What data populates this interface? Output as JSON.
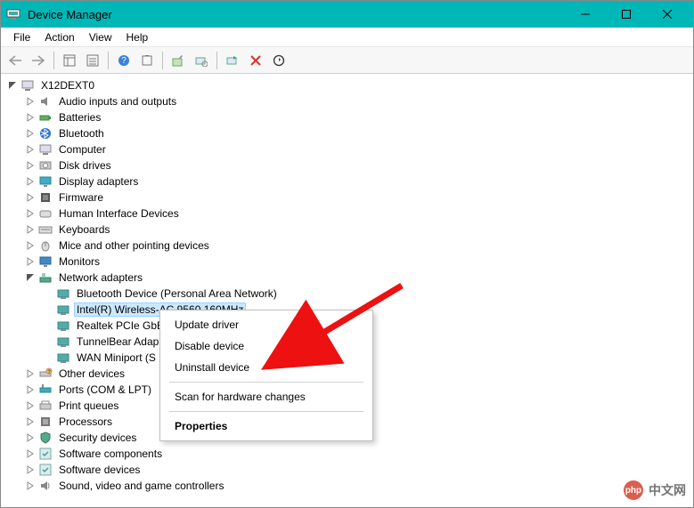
{
  "window": {
    "title": "Device Manager"
  },
  "menu": {
    "file": "File",
    "action": "Action",
    "view": "View",
    "help": "Help"
  },
  "tree": {
    "root": "X12DEXT0",
    "categories": [
      {
        "name": "Audio inputs and outputs"
      },
      {
        "name": "Batteries"
      },
      {
        "name": "Bluetooth"
      },
      {
        "name": "Computer"
      },
      {
        "name": "Disk drives"
      },
      {
        "name": "Display adapters"
      },
      {
        "name": "Firmware"
      },
      {
        "name": "Human Interface Devices"
      },
      {
        "name": "Keyboards"
      },
      {
        "name": "Mice and other pointing devices"
      },
      {
        "name": "Monitors"
      },
      {
        "name": "Network adapters",
        "children": [
          "Bluetooth Device (Personal Area Network)",
          "Intel(R) Wireless-AC 9560 160MHz",
          "Realtek PCIe GbE",
          "TunnelBear Adap",
          "WAN Miniport (S"
        ],
        "selected_index": 1
      },
      {
        "name": "Other devices"
      },
      {
        "name": "Ports (COM & LPT)"
      },
      {
        "name": "Print queues"
      },
      {
        "name": "Processors"
      },
      {
        "name": "Security devices"
      },
      {
        "name": "Software components"
      },
      {
        "name": "Software devices"
      },
      {
        "name": "Sound, video and game controllers"
      }
    ]
  },
  "context_menu": {
    "update": "Update driver",
    "disable": "Disable device",
    "uninstall": "Uninstall device",
    "scan": "Scan for hardware changes",
    "properties": "Properties"
  },
  "watermark": {
    "badge": "php",
    "text": "中文网"
  }
}
